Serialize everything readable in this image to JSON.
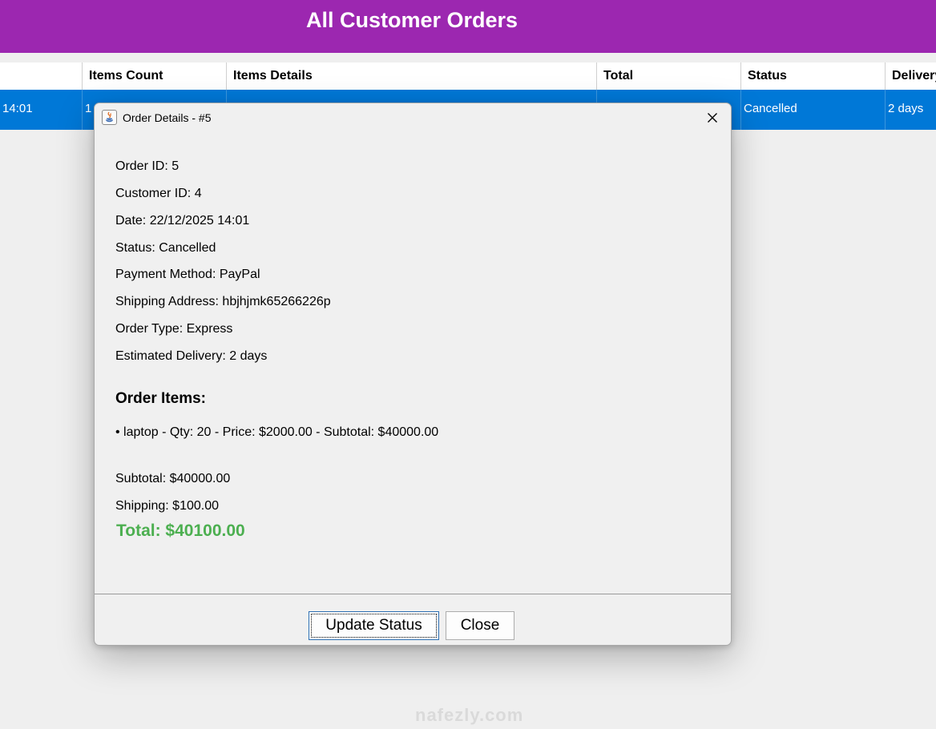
{
  "colors": {
    "accent": "#9c27b0",
    "selection": "#0078d7",
    "total": "#4caf50"
  },
  "main": {
    "title": "All Customer Orders",
    "table": {
      "columns": [
        "",
        "Items Count",
        "Items Details",
        "Total",
        "Status",
        "Delivery"
      ],
      "rows": [
        [
          "14:01",
          "1",
          "",
          "",
          "Cancelled",
          "2 days"
        ]
      ]
    }
  },
  "dialog": {
    "title": "Order Details - #5",
    "icon": "java-icon",
    "details": [
      "Order ID: 5",
      "Customer ID: 4",
      "Date: 22/12/2025 14:01",
      "Status: Cancelled",
      "Payment Method: PayPal",
      "Shipping Address: hbjhjmk65266226p",
      "Order Type: Express",
      "Estimated Delivery: 2 days"
    ],
    "items_title": "Order Items:",
    "items": [
      "• laptop - Qty: 20 - Price: $2000.00 - Subtotal: $40000.00"
    ],
    "subtotal": "Subtotal: $40000.00",
    "shipping": "Shipping: $100.00",
    "total": "Total: $40100.00",
    "buttons": {
      "update": "Update Status",
      "close": "Close"
    }
  },
  "watermark": "nafezly.com"
}
